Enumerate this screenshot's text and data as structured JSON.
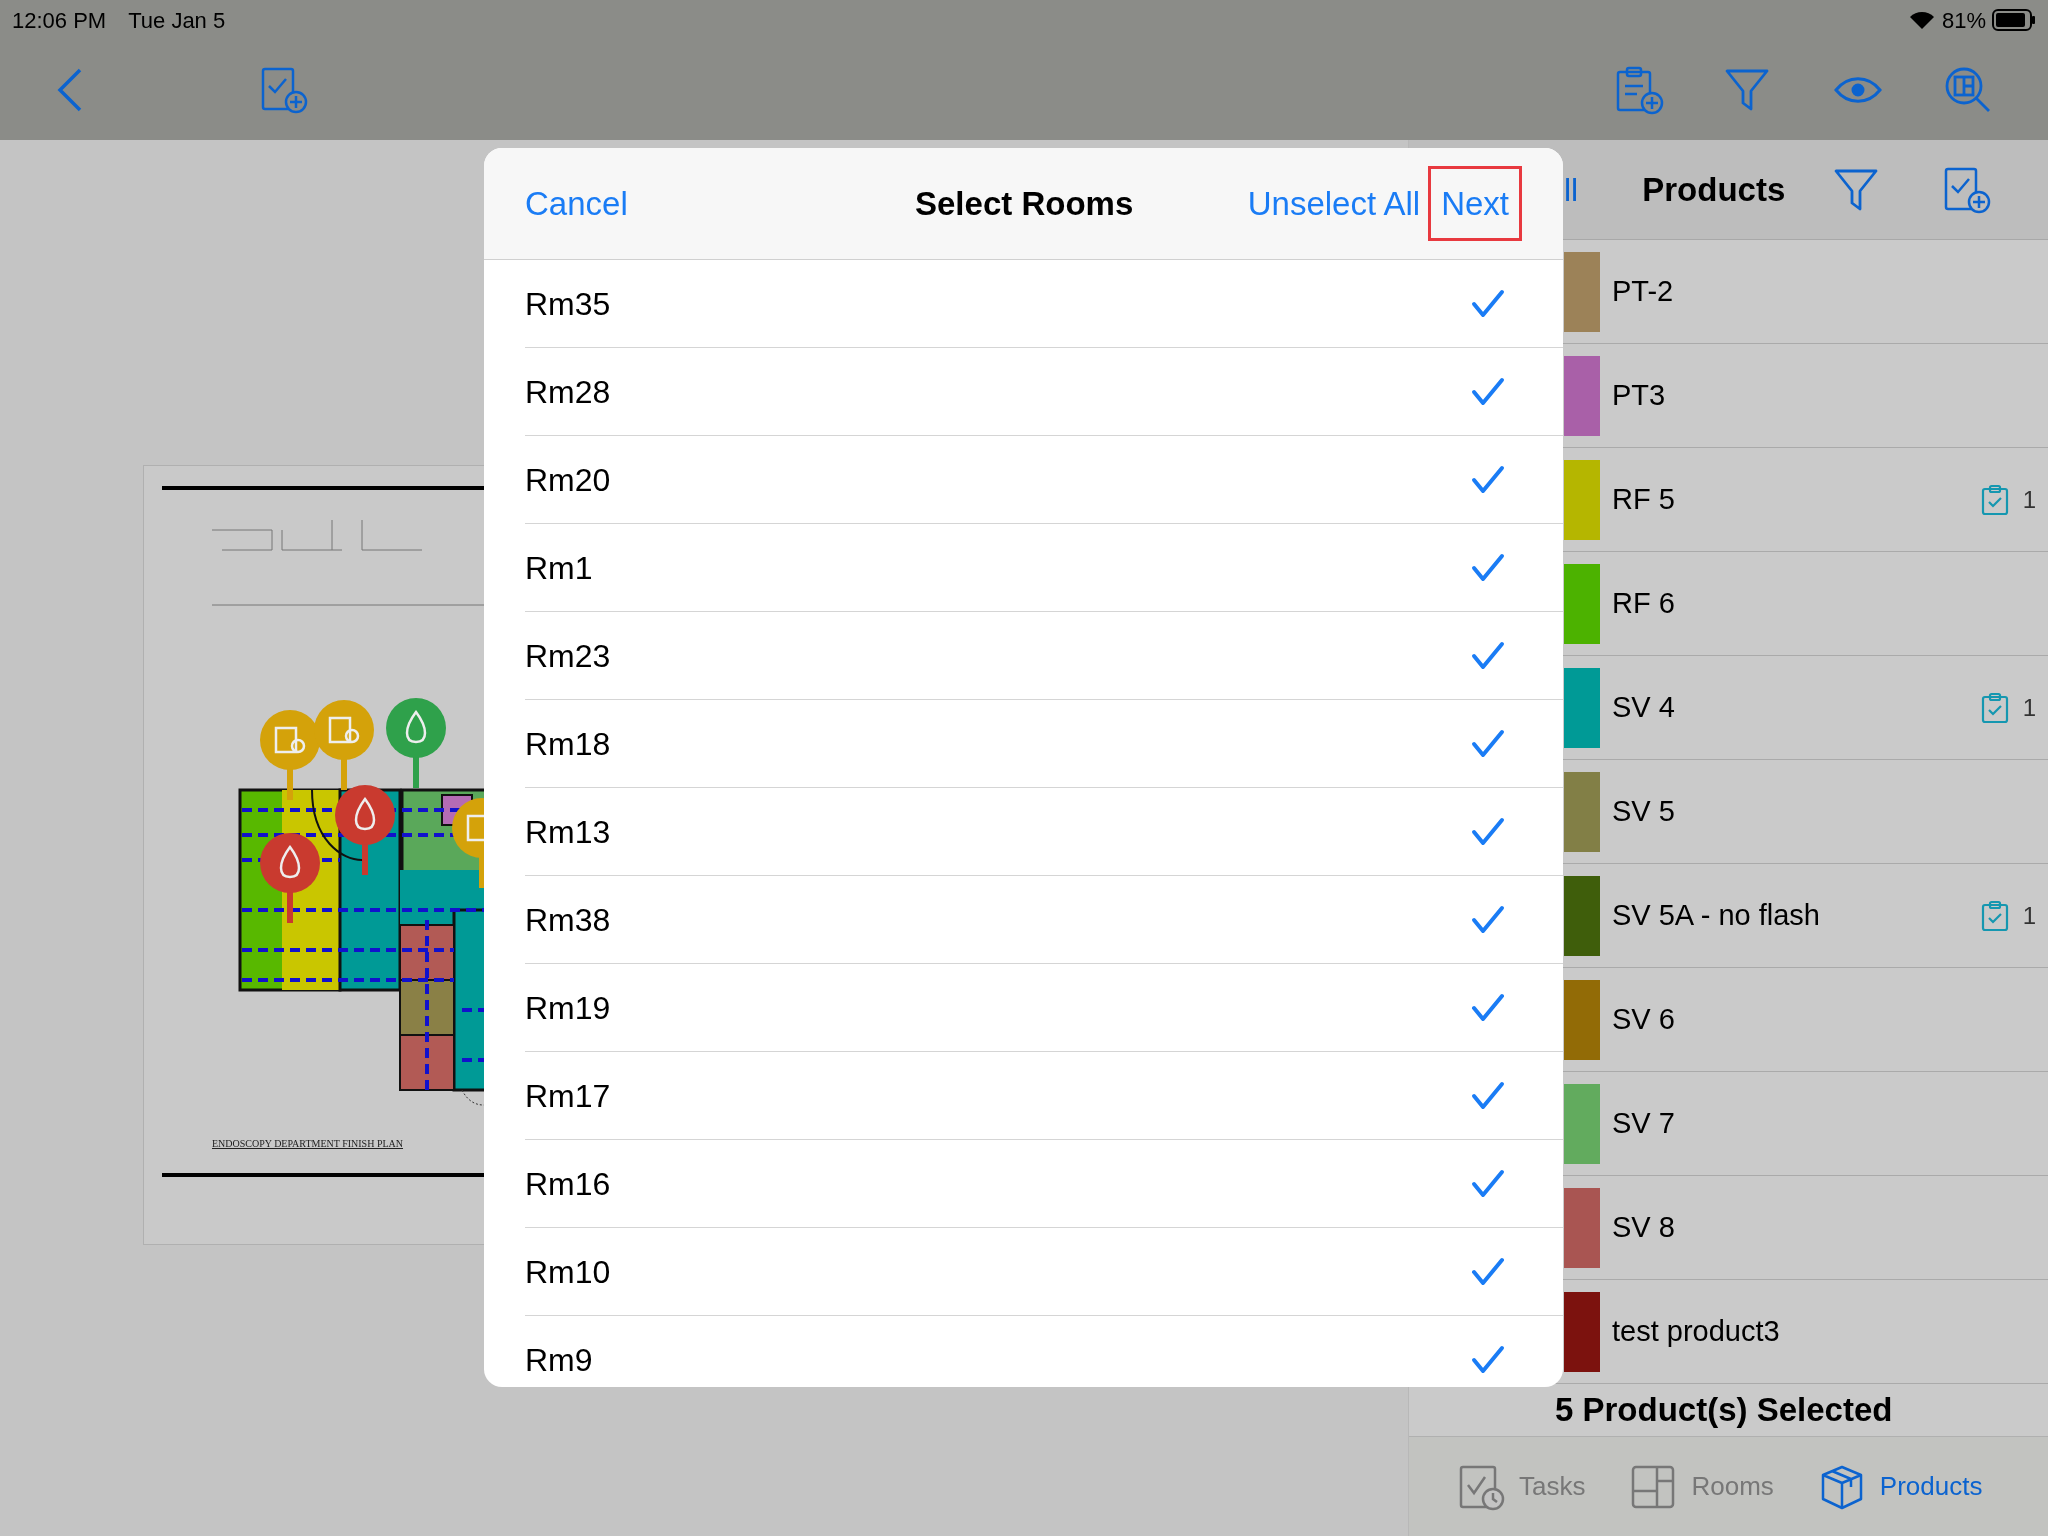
{
  "status_bar": {
    "time": "12:06 PM",
    "date": "Tue Jan 5",
    "battery": "81%"
  },
  "floor_plan": {
    "title": "ENDOSCOPY DEPARTMENT FINISH PLAN"
  },
  "modal": {
    "cancel": "Cancel",
    "title": "Select Rooms",
    "unselect_all": "Unselect All",
    "next": {
      "label": "Next",
      "highlighted": true
    },
    "rooms": [
      {
        "name": "Rm35",
        "checked": true
      },
      {
        "name": "Rm28",
        "checked": true
      },
      {
        "name": "Rm20",
        "checked": true
      },
      {
        "name": "Rm1",
        "checked": true
      },
      {
        "name": "Rm23",
        "checked": true
      },
      {
        "name": "Rm18",
        "checked": true
      },
      {
        "name": "Rm13",
        "checked": true
      },
      {
        "name": "Rm38",
        "checked": true
      },
      {
        "name": "Rm19",
        "checked": true
      },
      {
        "name": "Rm17",
        "checked": true
      },
      {
        "name": "Rm16",
        "checked": true
      },
      {
        "name": "Rm10",
        "checked": true
      },
      {
        "name": "Rm9",
        "checked": true
      }
    ]
  },
  "products_panel": {
    "header_left": "ll",
    "title": "Products",
    "items": [
      {
        "name": "PT-2",
        "color": "#9c8258"
      },
      {
        "name": "PT3",
        "color": "#a960a8"
      },
      {
        "name": "RF 5",
        "color": "#b5b600",
        "task_count": "1"
      },
      {
        "name": "RF 6",
        "color": "#4cb200"
      },
      {
        "name": "SV 4",
        "color": "#009a96",
        "task_count": "1"
      },
      {
        "name": "SV 5",
        "color": "#827f46"
      },
      {
        "name": "SV 5A - no flash",
        "color": "#3f5e0b",
        "task_count": "1"
      },
      {
        "name": "SV 6",
        "color": "#926b06"
      },
      {
        "name": "SV 7",
        "color": "#62ab5e"
      },
      {
        "name": "SV 8",
        "color": "#a95552"
      },
      {
        "name": "test product3",
        "color": "#7c120e"
      }
    ],
    "summary": "5 Product(s) Selected"
  },
  "tabs": [
    {
      "label": "Tasks",
      "selected": false,
      "kind": "tasks"
    },
    {
      "label": "Rooms",
      "selected": false,
      "kind": "rooms"
    },
    {
      "label": "Products",
      "selected": true,
      "kind": "products"
    }
  ]
}
